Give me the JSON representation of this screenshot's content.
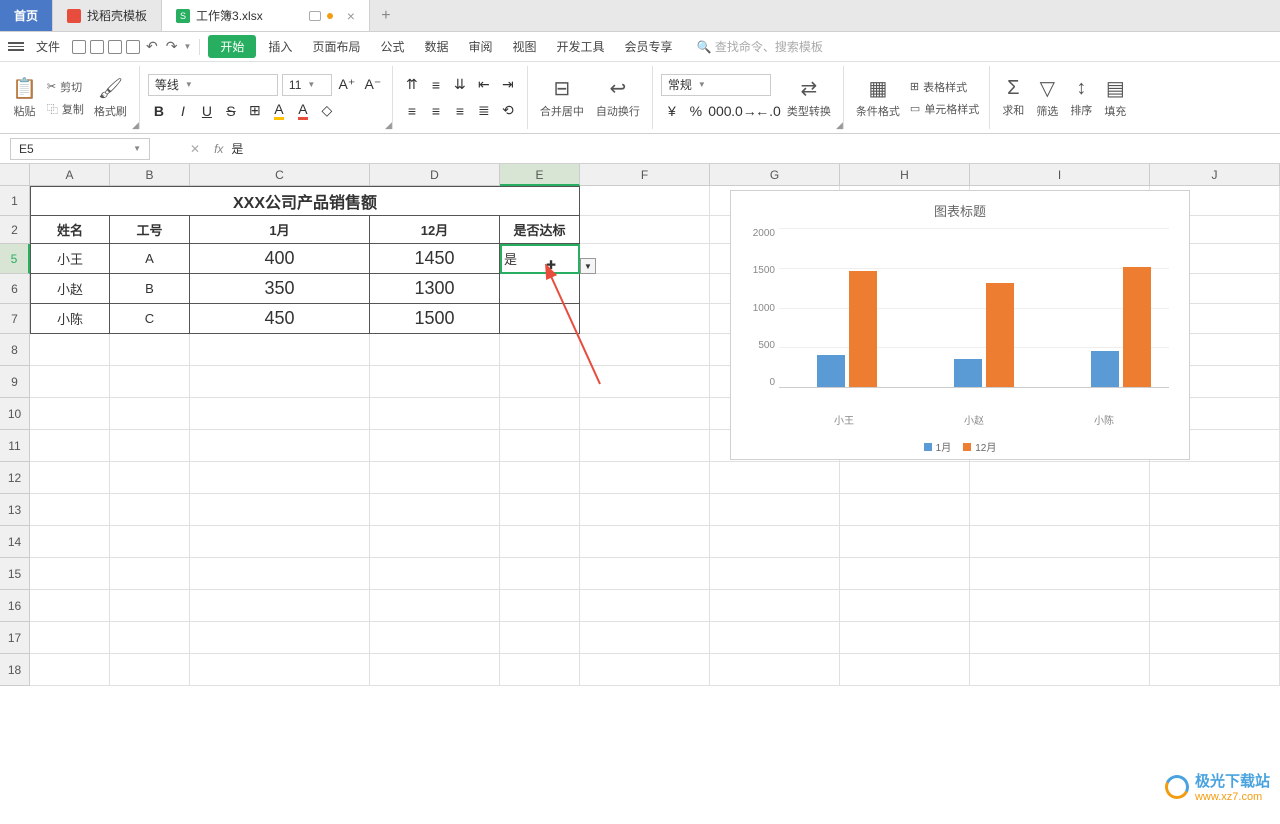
{
  "tabs": {
    "home": "首页",
    "template": "找稻壳模板",
    "file": "工作簿3.xlsx"
  },
  "menu": {
    "file": "文件",
    "start": "开始",
    "insert": "插入",
    "layout": "页面布局",
    "formula": "公式",
    "data": "数据",
    "review": "审阅",
    "view": "视图",
    "dev": "开发工具",
    "member": "会员专享",
    "search": "查找命令、搜索模板"
  },
  "ribbon": {
    "paste": "粘贴",
    "cut": "剪切",
    "copy": "复制",
    "brush": "格式刷",
    "font": "等线",
    "size": "11",
    "merge": "合并居中",
    "wrap": "自动换行",
    "numfmt": "常规",
    "typeconv": "类型转换",
    "cond": "条件格式",
    "tblstyle": "表格样式",
    "cellstyle": "单元格样式",
    "sum": "求和",
    "filter": "筛选",
    "sort": "排序",
    "fill": "填充"
  },
  "namebox": "E5",
  "fx": "是",
  "cols": [
    "A",
    "B",
    "C",
    "D",
    "E",
    "F",
    "G",
    "H",
    "I",
    "J"
  ],
  "table": {
    "title": "XXX公司产品销售额",
    "headers": {
      "name": "姓名",
      "id": "工号",
      "m1": "1月",
      "m12": "12月",
      "ok": "是否达标"
    },
    "rows": [
      {
        "name": "小王",
        "id": "A",
        "m1": "400",
        "m12": "1450",
        "ok": "是"
      },
      {
        "name": "小赵",
        "id": "B",
        "m1": "350",
        "m12": "1300",
        "ok": ""
      },
      {
        "name": "小陈",
        "id": "C",
        "m1": "450",
        "m12": "1500",
        "ok": ""
      }
    ]
  },
  "chart_data": {
    "type": "bar",
    "title": "图表标题",
    "categories": [
      "小王",
      "小赵",
      "小陈"
    ],
    "series": [
      {
        "name": "1月",
        "values": [
          400,
          350,
          450
        ],
        "color": "#5b9bd5"
      },
      {
        "name": "12月",
        "values": [
          1450,
          1300,
          1500
        ],
        "color": "#ed7d31"
      }
    ],
    "ylim": [
      0,
      2000
    ],
    "yticks": [
      0,
      500,
      1000,
      1500,
      2000
    ]
  },
  "watermark": {
    "brand": "极光下载站",
    "url": "www.xz7.com"
  }
}
